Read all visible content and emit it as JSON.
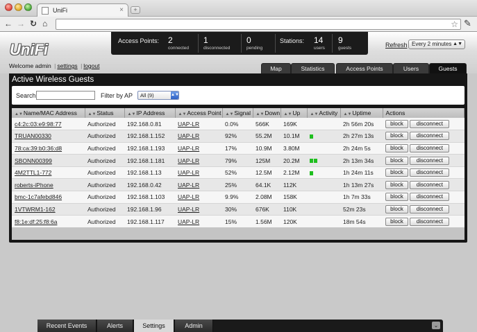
{
  "browser": {
    "tab_title": "UniFi",
    "url": ""
  },
  "app": {
    "logo": "UniFi",
    "welcome_text": "Welcome admin",
    "settings_link": "settings",
    "logout_link": "logout",
    "stats": {
      "access_points_label": "Access Points:",
      "connected_count": "2",
      "connected_label": "connected",
      "disconnected_count": "1",
      "disconnected_label": "disconnected",
      "pending_count": "0",
      "pending_label": "pending",
      "stations_label": "Stations:",
      "users_count": "14",
      "users_label": "users",
      "guests_count": "9",
      "guests_label": "guests"
    },
    "refresh_label": "Refresh",
    "refresh_interval": "Every 2 minutes",
    "tabs": [
      "Map",
      "Statistics",
      "Access Points",
      "Users",
      "Guests"
    ],
    "active_tab": "Guests"
  },
  "panel": {
    "title": "Active Wireless Guests",
    "search_label": "Search",
    "search_value": "",
    "filter_label": "Filter by AP",
    "filter_value": "All (9)",
    "columns": [
      "Name/MAC Address",
      "Status",
      "IP Address",
      "Access Point",
      "Signal",
      "Down",
      "Up",
      "Activity",
      "Uptime",
      "Actions"
    ],
    "block_label": "block",
    "disconnect_label": "disconnect",
    "rows": [
      {
        "name": "c4:2c:03:e9:98:77",
        "status": "Authorized",
        "ip": "192.168.0.81",
        "ap": "UAP-LR",
        "signal": "0.0%",
        "down": "566K",
        "up": "169K",
        "activity": 0,
        "uptime": "2h 56m 20s"
      },
      {
        "name": "TRUAN00330",
        "status": "Authorized",
        "ip": "192.168.1.152",
        "ap": "UAP-LR",
        "signal": "92%",
        "down": "55.2M",
        "up": "10.1M",
        "activity": 1,
        "uptime": "2h 27m 13s"
      },
      {
        "name": "78:ca:39:b0:36:d8",
        "status": "Authorized",
        "ip": "192.168.1.193",
        "ap": "UAP-LR",
        "signal": "17%",
        "down": "10.9M",
        "up": "3.80M",
        "activity": 0,
        "uptime": "2h 24m 5s"
      },
      {
        "name": "SBONN00399",
        "status": "Authorized",
        "ip": "192.168.1.181",
        "ap": "UAP-LR",
        "signal": "79%",
        "down": "125M",
        "up": "20.2M",
        "activity": 2,
        "uptime": "2h 13m 34s"
      },
      {
        "name": "4M2TTL1-772",
        "status": "Authorized",
        "ip": "192.168.1.13",
        "ap": "UAP-LR",
        "signal": "52%",
        "down": "12.5M",
        "up": "2.12M",
        "activity": 1,
        "uptime": "1h 24m 11s"
      },
      {
        "name": "roberts-iPhone",
        "status": "Authorized",
        "ip": "192.168.0.42",
        "ap": "UAP-LR",
        "signal": "25%",
        "down": "64.1K",
        "up": "112K",
        "activity": 0,
        "uptime": "1h 13m 27s"
      },
      {
        "name": "bmc-1c7afebd846",
        "status": "Authorized",
        "ip": "192.168.1.103",
        "ap": "UAP-LR",
        "signal": "9.9%",
        "down": "2.08M",
        "up": "158K",
        "activity": 0,
        "uptime": "1h 7m 33s"
      },
      {
        "name": "1VTWRM1-162",
        "status": "Authorized",
        "ip": "192.168.1.96",
        "ap": "UAP-LR",
        "signal": "30%",
        "down": "676K",
        "up": "110K",
        "activity": 0,
        "uptime": "52m 23s"
      },
      {
        "name": "f8:1e:df:25:f8:6a",
        "status": "Authorized",
        "ip": "192.168.1.117",
        "ap": "UAP-LR",
        "signal": "15%",
        "down": "1.56M",
        "up": "120K",
        "activity": 0,
        "uptime": "18m 54s"
      }
    ]
  },
  "bottom_bar": {
    "items": [
      "Recent Events",
      "Alerts",
      "Settings",
      "Admin"
    ],
    "active": "Settings"
  },
  "colors": {
    "activity_green": "#1fbf1f",
    "panel_bg": "#161616"
  }
}
